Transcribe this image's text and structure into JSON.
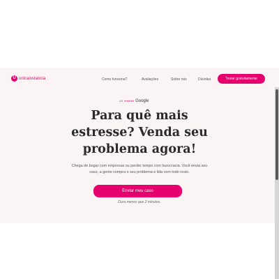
{
  "header": {
    "logo_mark": "U",
    "logo_text": "unicainstancia",
    "nav": [
      "Como funciona?",
      "Avaliações",
      "Sobre nós",
      "Dúvidas"
    ],
    "cta_label": "Testar gratuitamente"
  },
  "hero": {
    "rating_score": "4.8",
    "rating_stars": "★★★★★",
    "rating_provider": "Google",
    "headline": "Para quê mais estresse? Venda seu problema agora!",
    "subtext": "Chega de brigar com empresas ou perder tempo com burocracia. Você envia seu caso, a gente compra o seu problema e lida com todo resto.",
    "cta_label": "Enviar meu caso",
    "duration_note": "Dura menos que 2 minutos."
  },
  "colors": {
    "accent": "#e6006e",
    "hero_background": "#fbf4f5"
  }
}
